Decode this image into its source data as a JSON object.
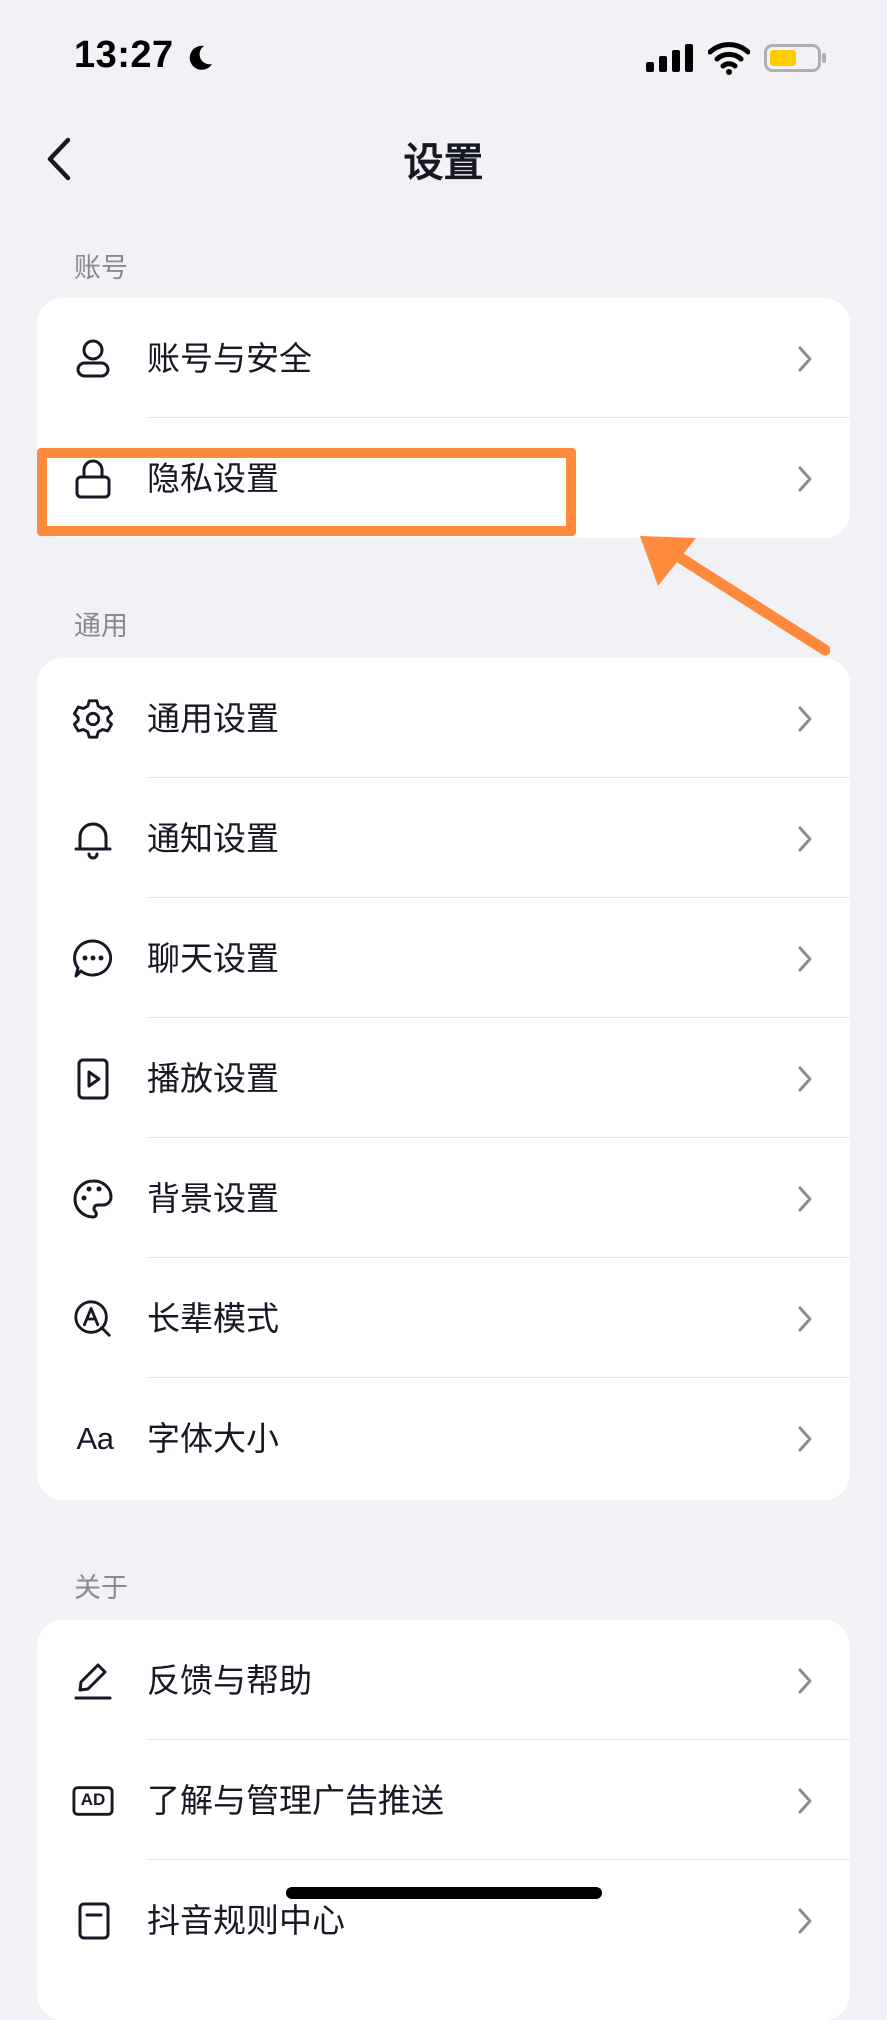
{
  "status_bar": {
    "time": "13:27",
    "moon_icon": "moon-icon",
    "signal_icon": "cellular-signal-icon",
    "wifi_icon": "wifi-icon",
    "battery_icon": "battery-icon",
    "battery_color": "#FFCC00"
  },
  "nav": {
    "title": "设置",
    "back_icon": "chevron-left-icon"
  },
  "sections": {
    "account": {
      "label": "账号",
      "items": [
        {
          "label": "账号与安全",
          "icon": "person-icon"
        },
        {
          "label": "隐私设置",
          "icon": "lock-icon"
        }
      ]
    },
    "general": {
      "label": "通用",
      "items": [
        {
          "label": "通用设置",
          "icon": "gear-icon"
        },
        {
          "label": "通知设置",
          "icon": "bell-icon"
        },
        {
          "label": "聊天设置",
          "icon": "chat-bubble-icon"
        },
        {
          "label": "播放设置",
          "icon": "play-icon"
        },
        {
          "label": "背景设置",
          "icon": "palette-icon"
        },
        {
          "label": "长辈模式",
          "icon": "elder-mode-icon"
        },
        {
          "label": "字体大小",
          "icon": "font-size-icon",
          "icon_text": "Aa"
        }
      ]
    },
    "about": {
      "label": "关于",
      "items": [
        {
          "label": "反馈与帮助",
          "icon": "pencil-icon"
        },
        {
          "label": "了解与管理广告推送",
          "icon": "ad-icon",
          "icon_text": "AD"
        },
        {
          "label": "抖音规则中心",
          "icon": "document-icon"
        }
      ]
    }
  },
  "annotation": {
    "highlight_color": "#FF8A3D"
  },
  "colors": {
    "background": "#F2F2F6",
    "card": "#FFFFFF",
    "text_primary": "#161823",
    "text_secondary": "#8A8B91",
    "chevron": "#8A8B91"
  }
}
